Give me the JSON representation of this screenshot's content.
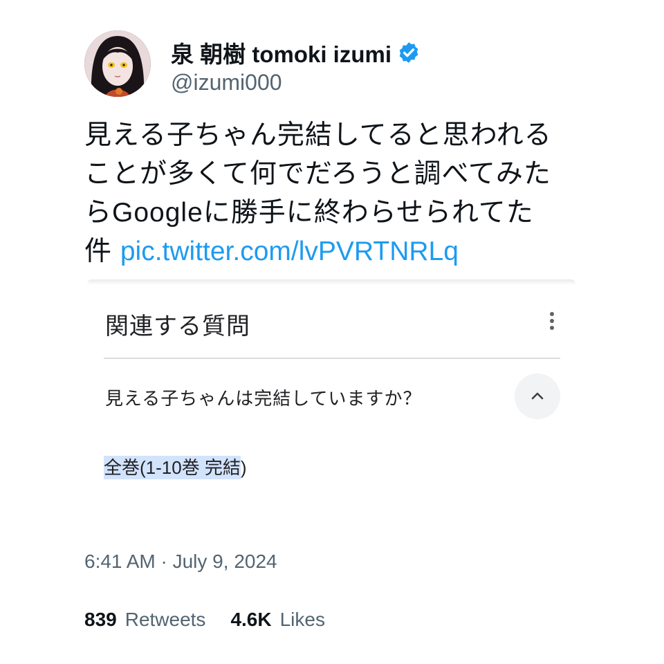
{
  "author": {
    "display_name": "泉 朝樹 tomoki izumi",
    "handle": "@izumi000",
    "verified_icon": "verified-badge-icon",
    "verified_color": "#1d9bf0"
  },
  "tweet": {
    "lines": [
      "見える子ちゃん完結してると思われる",
      "ことが多くて何でだろうと調べてみた",
      "らGoogleに勝手に終わらせられてた"
    ],
    "last_line_prefix": "件 ",
    "link_text": "pic.twitter.com/lvPVRTNRLq",
    "link_color": "#1d9bf0"
  },
  "embed": {
    "title": "関連する質問",
    "more_icon": "more-vertical-icon",
    "question": "見える子ちゃんは完結していますか？",
    "collapse_icon": "chevron-up-icon",
    "answer_highlighted": "全巻(1-10巻 完結",
    "answer_rest": ")",
    "highlight_color": "#d2e3fc"
  },
  "meta": {
    "timestamp": "6:41 AM · July 9, 2024"
  },
  "stats": {
    "retweets_count": "839",
    "retweets_label": "Retweets",
    "likes_count": "4.6K",
    "likes_label": "Likes"
  }
}
